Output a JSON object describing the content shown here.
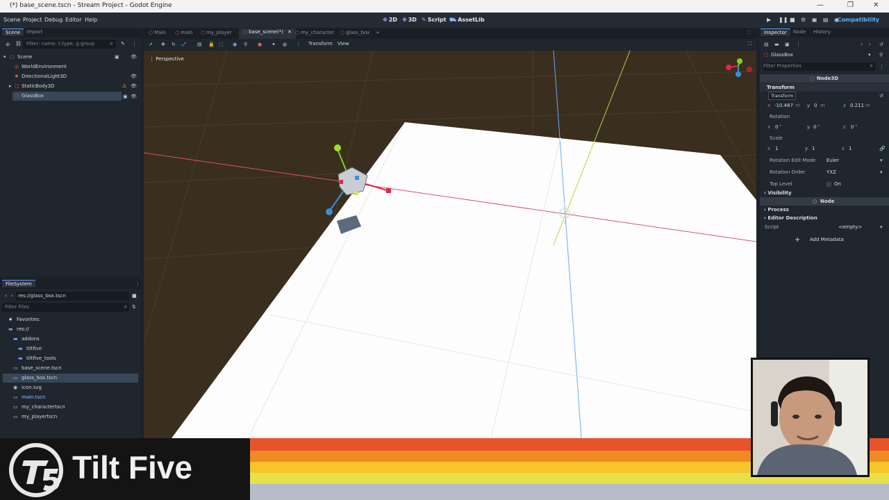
{
  "window": {
    "title": "(*) base_scene.tscn - Stream Project - Godot Engine",
    "minimize": "—",
    "maximize": "❐",
    "close": "✕"
  },
  "menu": {
    "items": [
      "Scene",
      "Project",
      "Debug",
      "Editor",
      "Help"
    ],
    "workspaces": [
      {
        "icon": "✥",
        "label": "2D"
      },
      {
        "icon": "✥",
        "label": "3D"
      },
      {
        "icon": "✎",
        "label": "Script"
      },
      {
        "icon": "⛟",
        "label": "AssetLib"
      }
    ],
    "renderer": "Compatibility"
  },
  "scene_dock": {
    "tabs": [
      "Scene",
      "Import"
    ],
    "filter_placeholder": "Filter: name, t:type, g:group",
    "nodes": [
      {
        "label": "Scene",
        "icon_color": "#e05a5a"
      },
      {
        "label": "WorldEnvironment",
        "icon_color": "#e05a5a"
      },
      {
        "label": "DirectionalLight3D",
        "icon_color": "#e05a5a"
      },
      {
        "label": "StaticBody3D",
        "icon_color": "#e05a5a"
      },
      {
        "label": "GlassBox",
        "icon_color": "#e05a5a"
      }
    ]
  },
  "scene_tabs": [
    {
      "label": "Main",
      "active": false
    },
    {
      "label": "main",
      "active": false
    },
    {
      "label": "my_player",
      "active": false
    },
    {
      "label": "base_scene(*)",
      "active": true
    },
    {
      "label": "my_character",
      "active": false
    },
    {
      "label": "glass_box",
      "active": false
    }
  ],
  "viewport": {
    "toolbar_menus": [
      "Transform",
      "View"
    ],
    "perspective_label": "Perspective"
  },
  "filesystem": {
    "title": "FileSystem",
    "path": "res://glass_box.tscn",
    "filter_placeholder": "Filter Files",
    "items": [
      {
        "label": "Favorites:",
        "indent": 0,
        "icon": "★"
      },
      {
        "label": "res://",
        "indent": 0,
        "icon": "▬"
      },
      {
        "label": "addons",
        "indent": 1,
        "icon": "▬"
      },
      {
        "label": "tiltfive",
        "indent": 2,
        "icon": "▬"
      },
      {
        "label": "tiltfive_tools",
        "indent": 2,
        "icon": "▬"
      },
      {
        "label": "base_scene.tscn",
        "indent": 1,
        "icon": "▭"
      },
      {
        "label": "glass_box.tscn",
        "indent": 1,
        "icon": "▭"
      },
      {
        "label": "icon.svg",
        "indent": 1,
        "icon": "◉"
      },
      {
        "label": "main.tscn",
        "indent": 1,
        "icon": "▭"
      },
      {
        "label": "my_charactertscn",
        "indent": 1,
        "icon": "▭"
      },
      {
        "label": "my_playertscn",
        "indent": 1,
        "icon": "▭"
      }
    ]
  },
  "inspector": {
    "tabs": [
      "Inspector",
      "Node",
      "History"
    ],
    "object": "GlassBox",
    "filter_placeholder": "Filter Properties",
    "class_header": "Node3D",
    "transform_section": "Transform",
    "tooltip": "Transform",
    "position": {
      "x": "-10.467",
      "y": "0",
      "z": "0.211",
      "unit": "m"
    },
    "rotation_label": "Rotation",
    "rotation": {
      "x": "0",
      "y": "0",
      "z": "0",
      "unit": "°"
    },
    "scale_label": "Scale",
    "scale": {
      "x": "1",
      "y": "1",
      "z": "1"
    },
    "rotation_edit_mode_label": "Rotation Edit Mode",
    "rotation_edit_mode": "Euler",
    "rotation_order_label": "Rotation Order",
    "rotation_order": "YXZ",
    "top_level_label": "Top Level",
    "top_level_value": "On",
    "visibility": "Visibility",
    "node_header": "Node",
    "process": "Process",
    "editor_description": "Editor Description",
    "script_label": "Script",
    "script_value": "<empty>",
    "add_metadata": "Add Metadata"
  },
  "branding": {
    "logo_text": "Tilt Five",
    "stripe_colors": [
      "#e8542a",
      "#f08a24",
      "#f5c52a",
      "#e8e04a",
      "#b8bcc8"
    ]
  }
}
